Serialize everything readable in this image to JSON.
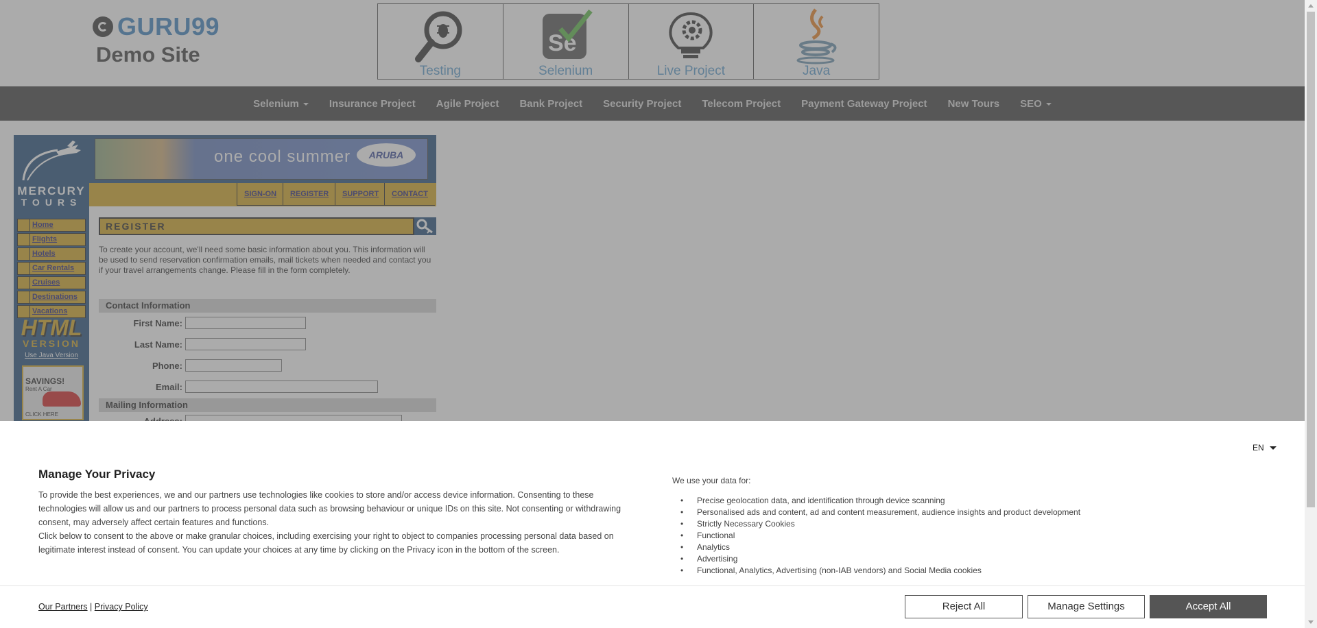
{
  "header": {
    "logo_brand": "GURU99",
    "logo_sub": "Demo Site",
    "top_links": [
      {
        "label": "Testing",
        "icon": "testing-magnifier-bug-icon"
      },
      {
        "label": "Selenium",
        "icon": "selenium-icon"
      },
      {
        "label": "Live Project",
        "icon": "lightbulb-gear-icon"
      },
      {
        "label": "Java",
        "icon": "java-cup-icon"
      }
    ]
  },
  "navbar": {
    "items": [
      "Selenium",
      "Insurance Project",
      "Agile Project",
      "Bank Project",
      "Security Project",
      "Telecom Project",
      "Payment Gateway Project",
      "New Tours",
      "SEO"
    ]
  },
  "mercury": {
    "brand_1": "MERCURY",
    "brand_2": "TOURS",
    "banner_text": "one cool summer",
    "banner_logo": "ARUBA",
    "tabs": [
      "SIGN-ON",
      "REGISTER",
      "SUPPORT",
      "CONTACT"
    ],
    "left_nav": [
      "Home",
      "Flights",
      "Hotels",
      "Car Rentals",
      "Cruises",
      "Destinations",
      "Vacations"
    ],
    "html_title": "HTML",
    "html_sub": "VERSION",
    "java_link": "Use Java Version",
    "ad_title": "SAVINGS!",
    "ad_sub": "Rent A Car",
    "ad_click": "CLICK HERE",
    "page_title": "REGISTER",
    "intro": "To create your account, we'll need some basic information about you. This information will be used to send reservation confirmation emails, mail tickets when needed and contact you if your travel arrangements change. Please fill in the form completely.",
    "contact_section": "Contact Information",
    "fields": {
      "first_name": {
        "label": "First Name:",
        "value": ""
      },
      "last_name": {
        "label": "Last Name:",
        "value": ""
      },
      "phone": {
        "label": "Phone:",
        "value": ""
      },
      "email": {
        "label": "Email:",
        "value": ""
      }
    },
    "mailing_section": "Mailing Information",
    "address_label": "Address:"
  },
  "consent": {
    "title": "Manage Your Privacy",
    "language": "EN",
    "paragraph_1": "To provide the best experiences, we and our partners use technologies like cookies to store and/or access device information. Consenting to these technologies will allow us and our partners to process personal data such as browsing behaviour or unique IDs on this site. Not consenting or withdrawing consent, may adversely affect certain features and functions.",
    "paragraph_2": "Click below to consent to the above or make granular choices, including exercising your right to object to companies processing personal data based on legitimate interest instead of consent. You can update your choices at any time by clicking on the Privacy icon in the bottom of the screen.",
    "use_heading": "We use your data for:",
    "purposes": [
      "Precise geolocation data, and identification through device scanning",
      "Personalised ads and content, ad and content measurement, audience insights and product development",
      "Strictly Necessary Cookies",
      "Functional",
      "Analytics",
      "Advertising",
      "Functional, Analytics, Advertising (non-IAB vendors) and Social Media cookies"
    ],
    "link_partners": "Our Partners",
    "link_separator": "|",
    "link_privacy": "Privacy Policy",
    "btn_reject": "Reject All",
    "btn_manage": "Manage Settings",
    "btn_accept": "Accept All"
  }
}
